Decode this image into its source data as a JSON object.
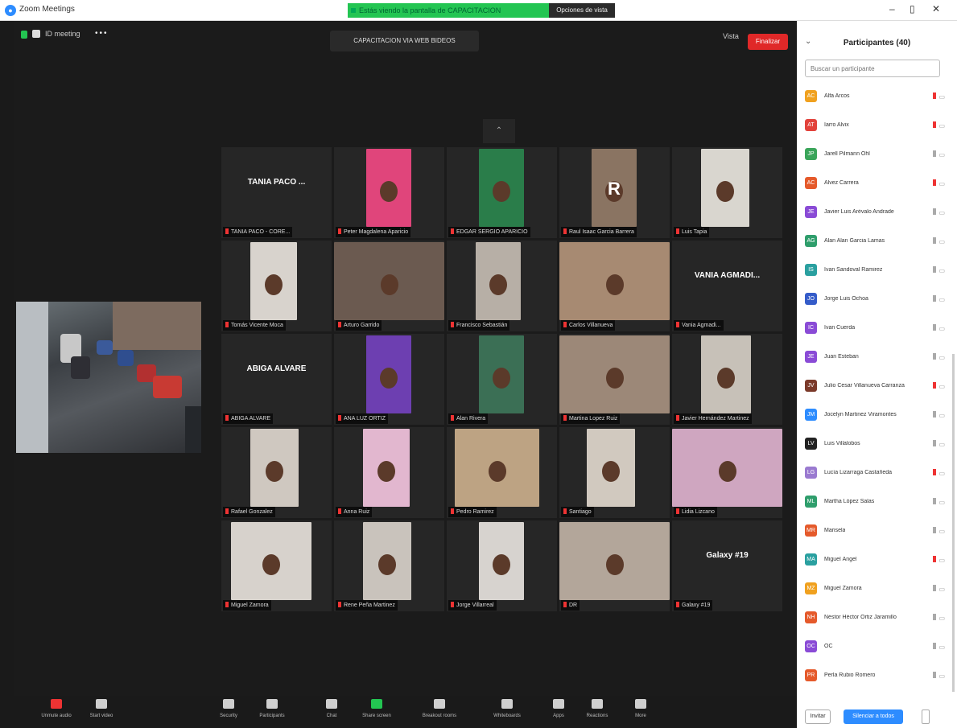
{
  "window": {
    "title": "Zoom Meetings",
    "share_banner": "Estás viendo la pantalla de CAPACITACION",
    "stop_label": "Opciones de vista"
  },
  "meeting": {
    "short_id": "ID meeting",
    "topic": "CAPACITACION VIA WEB BIDEOS",
    "view_label": "Vista",
    "more_label": "•••"
  },
  "colors": {
    "accent": "#2d8cff",
    "share_green": "#23c552",
    "leave_red": "#e02828",
    "mute_red": "#e33333"
  },
  "tiles": [
    {
      "name": "TANIA PACO ...",
      "label": "TANIA PACO - CORE..."
    },
    {
      "name": "",
      "label": "Peter Magdalena Aparicio"
    },
    {
      "name": "",
      "label": "EDGAR SERGIO APARICIO"
    },
    {
      "name": "R",
      "label": "Raul Isaac Garcia Barrera"
    },
    {
      "name": "",
      "label": "Luis Tapia"
    },
    {
      "name": "",
      "label": "Tomás Vicente Moca"
    },
    {
      "name": "",
      "label": "Arturo Garrido"
    },
    {
      "name": "",
      "label": "Francisco Sebastián"
    },
    {
      "name": "",
      "label": "Carlos Villanueva"
    },
    {
      "name": "VANIA AGMADI...",
      "label": "Vania Agmadi..."
    },
    {
      "name": "ABIGA ALVARE",
      "label": "ABIGA ALVARE"
    },
    {
      "name": "",
      "label": "ANA LUZ ORTIZ"
    },
    {
      "name": "",
      "label": "Alan Rivera"
    },
    {
      "name": "",
      "label": "Martina Lopez Ruiz"
    },
    {
      "name": "",
      "label": "Javier Hernández Martinez"
    },
    {
      "name": "",
      "label": "Rafael Gonzalez"
    },
    {
      "name": "",
      "label": "Anna Ruiz"
    },
    {
      "name": "",
      "label": "Pedro Ramirez"
    },
    {
      "name": "",
      "label": "Santiago"
    },
    {
      "name": "",
      "label": "Lidia Lizcano"
    },
    {
      "name": "",
      "label": "Miguel Zamora"
    },
    {
      "name": "",
      "label": "Rene Peña Martinez"
    },
    {
      "name": "",
      "label": "Jorge Villarreal"
    },
    {
      "name": "",
      "label": "DR"
    },
    {
      "name": "Galaxy #19",
      "label": "Galaxy #19"
    }
  ],
  "controls": [
    {
      "icon": "microphone-icon",
      "label": "Unmute audio"
    },
    {
      "icon": "video-camera-icon",
      "label": "Start video"
    },
    {
      "icon": "security-shield-icon",
      "label": "Security"
    },
    {
      "icon": "participants-icon",
      "label": "Participants"
    },
    {
      "icon": "chat-icon",
      "label": "Chat"
    },
    {
      "icon": "share-screen-icon",
      "label": "Share screen"
    },
    {
      "icon": "breakout-rooms-icon",
      "label": "Breakout rooms"
    },
    {
      "icon": "whiteboard-icon",
      "label": "Whiteboards"
    },
    {
      "icon": "apps-icon",
      "label": "Apps"
    },
    {
      "icon": "reactions-icon",
      "label": "Reactions"
    },
    {
      "icon": "more-icon",
      "label": "More"
    }
  ],
  "leave_label": "Finalizar",
  "panel": {
    "title": "Participantes (40)",
    "search_placeholder": "Buscar un participante",
    "participants": [
      {
        "initials": "AC",
        "color": "#f0a11f",
        "name": "Alfa Arcos",
        "muted": true
      },
      {
        "initials": "AT",
        "color": "#e2423b",
        "name": "Iarro Alvix",
        "muted": true
      },
      {
        "initials": "JP",
        "color": "#3aa55a",
        "name": "Jarell Pilmann Ohl",
        "muted": false
      },
      {
        "initials": "AC",
        "color": "#e55a2b",
        "name": "Alvez Carrera",
        "muted": true
      },
      {
        "initials": "JE",
        "color": "#8a4bd6",
        "name": "Javier Luis Arévalo Andrade",
        "muted": false
      },
      {
        "initials": "AG",
        "color": "#2f9e6c",
        "name": "Alan Alan Garcia Lamas",
        "muted": false
      },
      {
        "initials": "IS",
        "color": "#2aa0a0",
        "name": "Ivan Sandoval Ramirez",
        "muted": false
      },
      {
        "initials": "JO",
        "color": "#355cc9",
        "name": "Jorge Luis Ochoa",
        "muted": false
      },
      {
        "initials": "IC",
        "color": "#8a4bd6",
        "name": "Ivan Cuerda",
        "muted": false
      },
      {
        "initials": "JE",
        "color": "#8a4bd6",
        "name": "Juan Esteban",
        "muted": false
      },
      {
        "initials": "JV",
        "color": "#7b3a2a",
        "name": "Julio Cesar Villanueva Carranza",
        "muted": true
      },
      {
        "initials": "JM",
        "color": "#2d8cff",
        "name": "Jocelyn Martinez Viramontes",
        "muted": false
      },
      {
        "initials": "LV",
        "color": "#222222",
        "name": "Luis Villalobos",
        "muted": false
      },
      {
        "initials": "LG",
        "color": "#9a7ad0",
        "name": "Lucía Lizarraga Castañeda",
        "muted": true
      },
      {
        "initials": "ML",
        "color": "#2f9e6c",
        "name": "Martha López Salas",
        "muted": false
      },
      {
        "initials": "MR",
        "color": "#e55a2b",
        "name": "Marisela",
        "muted": false
      },
      {
        "initials": "MA",
        "color": "#2aa0a0",
        "name": "Miguel Ángel",
        "muted": true
      },
      {
        "initials": "MZ",
        "color": "#f0a11f",
        "name": "Miguel Zamora",
        "muted": false
      },
      {
        "initials": "NH",
        "color": "#e55a2b",
        "name": "Néstor Héctor Ortiz Jaramillo",
        "muted": false
      },
      {
        "initials": "OC",
        "color": "#8a4bd6",
        "name": "OC",
        "muted": false
      },
      {
        "initials": "PR",
        "color": "#e55a2b",
        "name": "Perla Rubio Romero",
        "muted": false
      }
    ],
    "invite_label": "Invitar",
    "mute_all_label": "Silenciar a todos"
  }
}
